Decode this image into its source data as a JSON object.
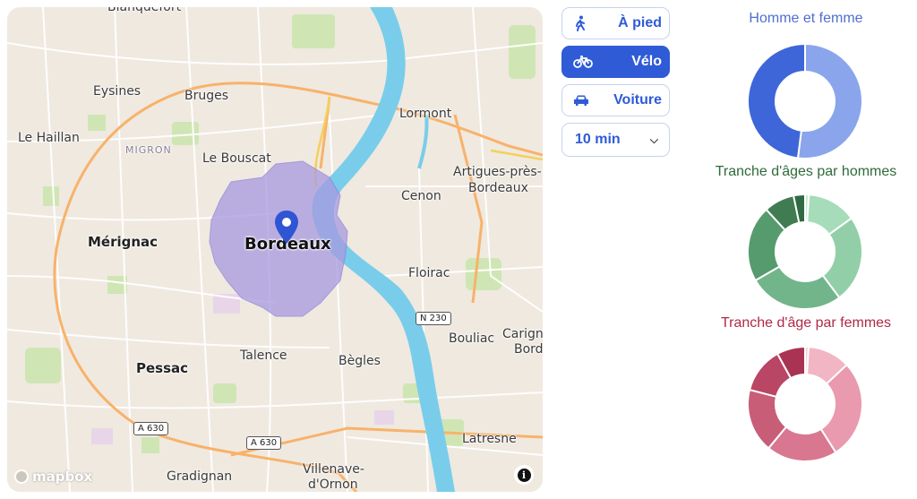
{
  "map": {
    "places": [
      {
        "id": "blanquefort",
        "label": "Blanquefort"
      },
      {
        "id": "eysines",
        "label": "Eysines"
      },
      {
        "id": "bruges",
        "label": "Bruges"
      },
      {
        "id": "lormont",
        "label": "Lormont"
      },
      {
        "id": "le-haillan",
        "label": "Le Haillan"
      },
      {
        "id": "migron",
        "label": "MIGRON"
      },
      {
        "id": "le-bouscat",
        "label": "Le Bouscat"
      },
      {
        "id": "artigues",
        "label": "Artigues-près-"
      },
      {
        "id": "artigues2",
        "label": "Bordeaux"
      },
      {
        "id": "cenon",
        "label": "Cenon"
      },
      {
        "id": "merignac",
        "label": "Mérignac"
      },
      {
        "id": "bordeaux",
        "label": "Bordeaux"
      },
      {
        "id": "floirac",
        "label": "Floirac"
      },
      {
        "id": "bouliac",
        "label": "Bouliac"
      },
      {
        "id": "carignan",
        "label": "Carign"
      },
      {
        "id": "carignan2",
        "label": "Bord"
      },
      {
        "id": "pessac",
        "label": "Pessac"
      },
      {
        "id": "talence",
        "label": "Talence"
      },
      {
        "id": "begles",
        "label": "Bègles"
      },
      {
        "id": "latresne",
        "label": "Latresne"
      },
      {
        "id": "gradignan",
        "label": "Gradignan"
      },
      {
        "id": "villenave",
        "label": "Villenave-"
      },
      {
        "id": "villenave2",
        "label": "d'Ornon"
      }
    ],
    "shields": {
      "n230": "N 230",
      "a630a": "A 630",
      "a630b": "A 630"
    },
    "attribution": "mapbox",
    "info_label": "i"
  },
  "modes": [
    {
      "label": "À pied",
      "icon": "walking-icon",
      "active": false
    },
    {
      "label": "Vélo",
      "icon": "bicycle-icon",
      "active": true
    },
    {
      "label": "Voiture",
      "icon": "car-icon",
      "active": false
    }
  ],
  "duration": {
    "value": "10 min"
  },
  "charts": {
    "gender": {
      "title": "Homme et femme",
      "color": "#4f6fd0"
    },
    "men": {
      "title": "Tranche d'âges par hommes",
      "color": "#2f6b3a"
    },
    "women": {
      "title": "Tranche d'âge par femmes",
      "color": "#b02a45"
    }
  },
  "chart_data": [
    {
      "type": "pie",
      "title": "Homme et femme",
      "values": [
        52,
        48
      ],
      "colors": [
        "#8aa5ec",
        "#3e66d9"
      ]
    },
    {
      "type": "pie",
      "title": "Tranche d'âges par hommes",
      "values": [
        1,
        13,
        23,
        25,
        20,
        8,
        3
      ],
      "colors": [
        "#c6ead2",
        "#a6dcb9",
        "#92cfa8",
        "#72b58b",
        "#569b6d",
        "#3f7c52",
        "#2f6a42"
      ]
    },
    {
      "type": "pie",
      "title": "Tranche d'âge par femmes",
      "values": [
        1,
        12,
        28,
        20,
        18,
        13,
        8
      ],
      "colors": [
        "#f6cfd8",
        "#f2b5c4",
        "#e99aae",
        "#d97690",
        "#c85d78",
        "#b94664",
        "#a93352"
      ]
    }
  ]
}
